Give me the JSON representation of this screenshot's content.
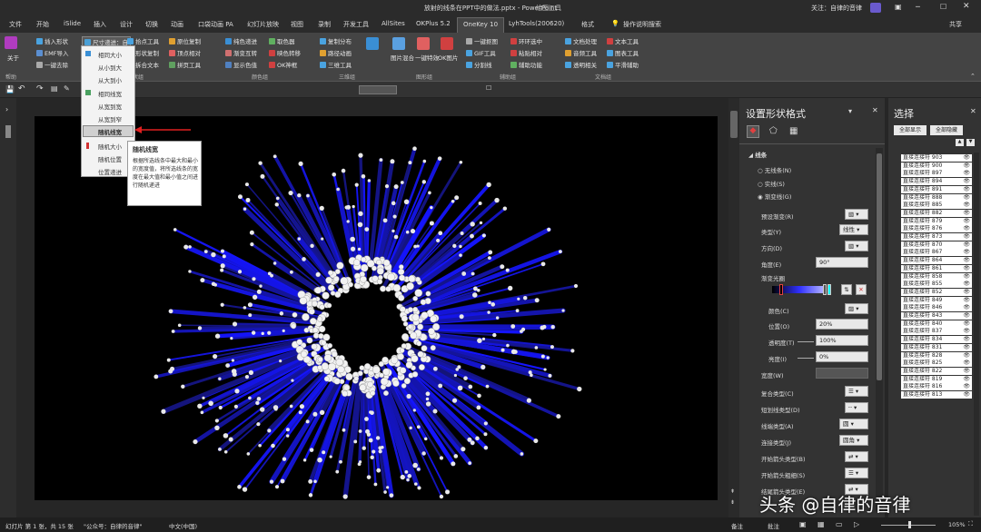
{
  "titlebar": {
    "title": "放射的线条在PPT中的做法.pptx - PowerPoint",
    "tool": "绘图工具",
    "follow": "关注：自律的音律",
    "share": "共享"
  },
  "tabs": [
    "文件",
    "开始",
    "iSlide",
    "插入",
    "设计",
    "切换",
    "动画",
    "口袋动画 PA",
    "幻灯片放映",
    "视图",
    "录制",
    "开发工具",
    "AllSites",
    "OKPlus 5.2",
    "OneKey 10",
    "LyhTools(200620)",
    "格式",
    "操作说明搜索"
  ],
  "ribbon": {
    "r1": [
      "插入形状",
      "尺寸递进：自",
      "拾点工具",
      "原位复制",
      "纯色递进",
      "取色器",
      "复制分布",
      "一键抠图",
      "环环选中",
      "文档处理",
      "文本工具"
    ],
    "r2": [
      "EMF导入",
      "形状复制",
      "顶点相对",
      "渐变互转",
      "映色转移",
      "路径动画",
      "图片混合",
      "一键特效",
      "OK图片",
      "GIF工具",
      "粘贴相对",
      "音频工具",
      "图表工具"
    ],
    "r3": [
      "一键去除",
      "拆合文本",
      "拼页工具",
      "显示色值",
      "OK神框",
      "三维工具",
      "分割线",
      "辅助功能",
      "透明相关",
      "平滑辅助"
    ],
    "groups": [
      "形状组",
      "颜色组",
      "三维组",
      "图形组",
      "辅助组",
      "文档组"
    ],
    "about": "关于",
    "help": "帮助"
  },
  "menu": {
    "items": [
      "相同大小",
      "从小到大",
      "从大到小",
      "相同线宽",
      "从宽到宽",
      "从宽到窄",
      "随机线宽",
      "随机大小",
      "随机位置",
      "位置递进"
    ],
    "selected": "随机线宽"
  },
  "tooltip": {
    "title": "随机线宽",
    "body": "根据所选线条中最大和最小的宽度值，将所选线条的宽度在最大值和最小值之间进行随机递进"
  },
  "format_panel": {
    "title": "设置形状格式",
    "section": "线条",
    "options": [
      "无线条(N)",
      "实线(S)",
      "渐变线(G)"
    ],
    "labels": [
      "预设渐变(R)",
      "类型(Y)",
      "方向(D)",
      "角度(E)",
      "渐变光圈",
      "颜色(C)",
      "位置(O)",
      "透明度(T)",
      "亮度(I)",
      "宽度(W)",
      "复合类型(C)",
      "短划线类型(D)",
      "线端类型(A)",
      "连接类型(J)",
      "开始箭头类型(B)",
      "开始箭头粗细(S)",
      "结尾箭头类型(E)"
    ],
    "values": {
      "type": "线性",
      "angle": "90°",
      "position": "20%",
      "transparency": "100%",
      "brightness": "0%",
      "cap": "圆",
      "join": "圆角"
    }
  },
  "selection_panel": {
    "title": "选择",
    "show_all": "全部显示",
    "hide_all": "全部隐藏",
    "items": [
      "直接连接符 903",
      "直接连接符 900",
      "直接连接符 897",
      "直接连接符 894",
      "直接连接符 891",
      "直接连接符 888",
      "直接连接符 885",
      "直接连接符 882",
      "直接连接符 879",
      "直接连接符 876",
      "直接连接符 873",
      "直接连接符 870",
      "直接连接符 867",
      "直接连接符 864",
      "直接连接符 861",
      "直接连接符 858",
      "直接连接符 855",
      "直接连接符 852",
      "直接连接符 849",
      "直接连接符 846",
      "直接连接符 843",
      "直接连接符 840",
      "直接连接符 837",
      "直接连接符 834",
      "直接连接符 831",
      "直接连接符 828",
      "直接连接符 825",
      "直接连接符 822",
      "直接连接符 819",
      "直接连接符 816",
      "直接连接符 813"
    ]
  },
  "status": {
    "slide": "幻灯片 第 1 张，共 15 张",
    "account": "\"公众号：自律的音律\"",
    "lang": "中文(中国)",
    "notes": "备注",
    "comments": "批注",
    "zoom": "105%"
  },
  "watermark": "头条 @自律的音律"
}
